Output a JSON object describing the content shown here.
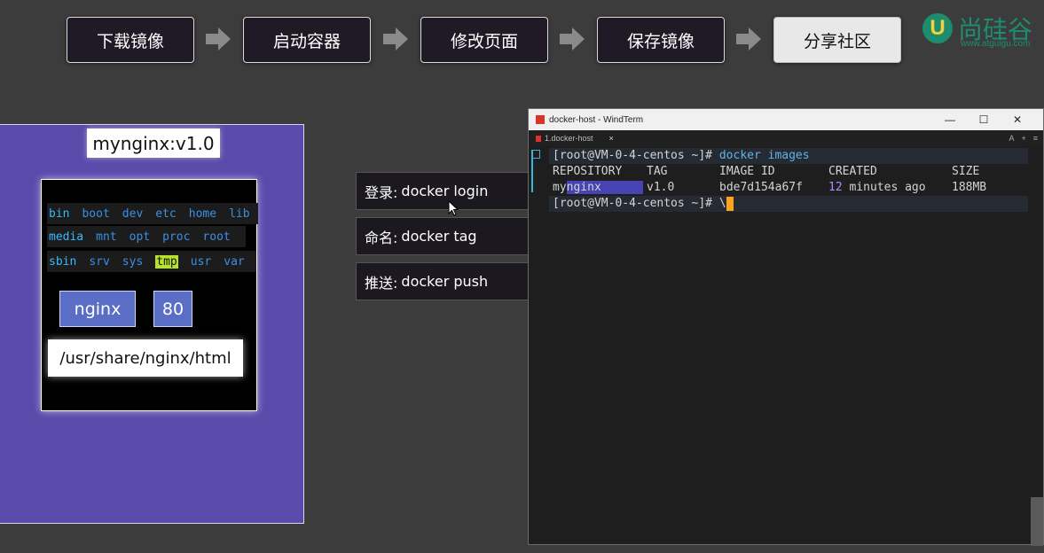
{
  "flow_steps": [
    "下载镜像",
    "启动容器",
    "修改页面",
    "保存镜像",
    "分享社区"
  ],
  "logo": {
    "text": "尚硅谷",
    "url": "www.atguigu.com",
    "mark": "U"
  },
  "image_panel": {
    "tag": "mynginx:v1.0",
    "dirs_row1": [
      "bin",
      "boot",
      "dev",
      "etc",
      "home",
      "lib"
    ],
    "dirs_row2": [
      "media",
      "mnt",
      "opt",
      "proc",
      "root"
    ],
    "dirs_row3": [
      "sbin",
      "srv",
      "sys",
      "tmp",
      "usr",
      "var"
    ],
    "app_name": "nginx",
    "port": "80",
    "html_path": "/usr/share/nginx/html"
  },
  "commands": [
    {
      "label": "登录:",
      "cmd": "docker login"
    },
    {
      "label": "命名:",
      "cmd": "docker tag"
    },
    {
      "label": "推送:",
      "cmd": "docker push"
    }
  ],
  "terminal": {
    "window_title": "docker-host - WindTerm",
    "tab_label": "1.docker-host",
    "tab_close": "×",
    "window_buttons": [
      "—",
      "☐",
      "✕"
    ],
    "tab_actions": [
      "A",
      "+",
      "≡"
    ],
    "prompt": "[root@VM-0-4-centos ~]#",
    "command": "docker images",
    "headers": [
      "REPOSITORY",
      "TAG",
      "IMAGE ID",
      "CREATED",
      "SIZE"
    ],
    "row": {
      "repo_prefix": "my",
      "repo_selected": "nginx",
      "tag": "v1.0",
      "image_id": "bde7d154a67f",
      "created_num": "12",
      "created_rest": "minutes ago",
      "size": "188MB"
    },
    "prompt2": "[root@VM-0-4-centos ~]#",
    "typed": "\\"
  }
}
